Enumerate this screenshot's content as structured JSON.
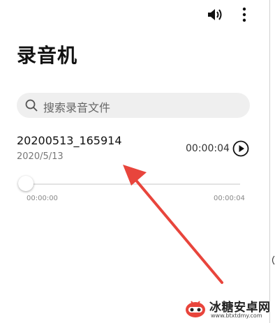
{
  "app": {
    "title": "录音机"
  },
  "toolbar": {
    "volume_icon": "volume-icon",
    "more_icon": "more-vertical-icon"
  },
  "search": {
    "placeholder": "搜索录音文件",
    "icon": "search-icon"
  },
  "recordings": [
    {
      "name": "20200513_165914",
      "date": "2020/5/13",
      "duration": "00:00:04"
    }
  ],
  "player": {
    "current_time": "00:00:00",
    "total_time": "00:00:04",
    "progress": 0
  },
  "watermark": {
    "text": "冰糖安卓网",
    "url": "www.btxtdmy.com"
  },
  "colors": {
    "annotation_arrow": "#e8453c",
    "search_bg": "#efefef"
  }
}
